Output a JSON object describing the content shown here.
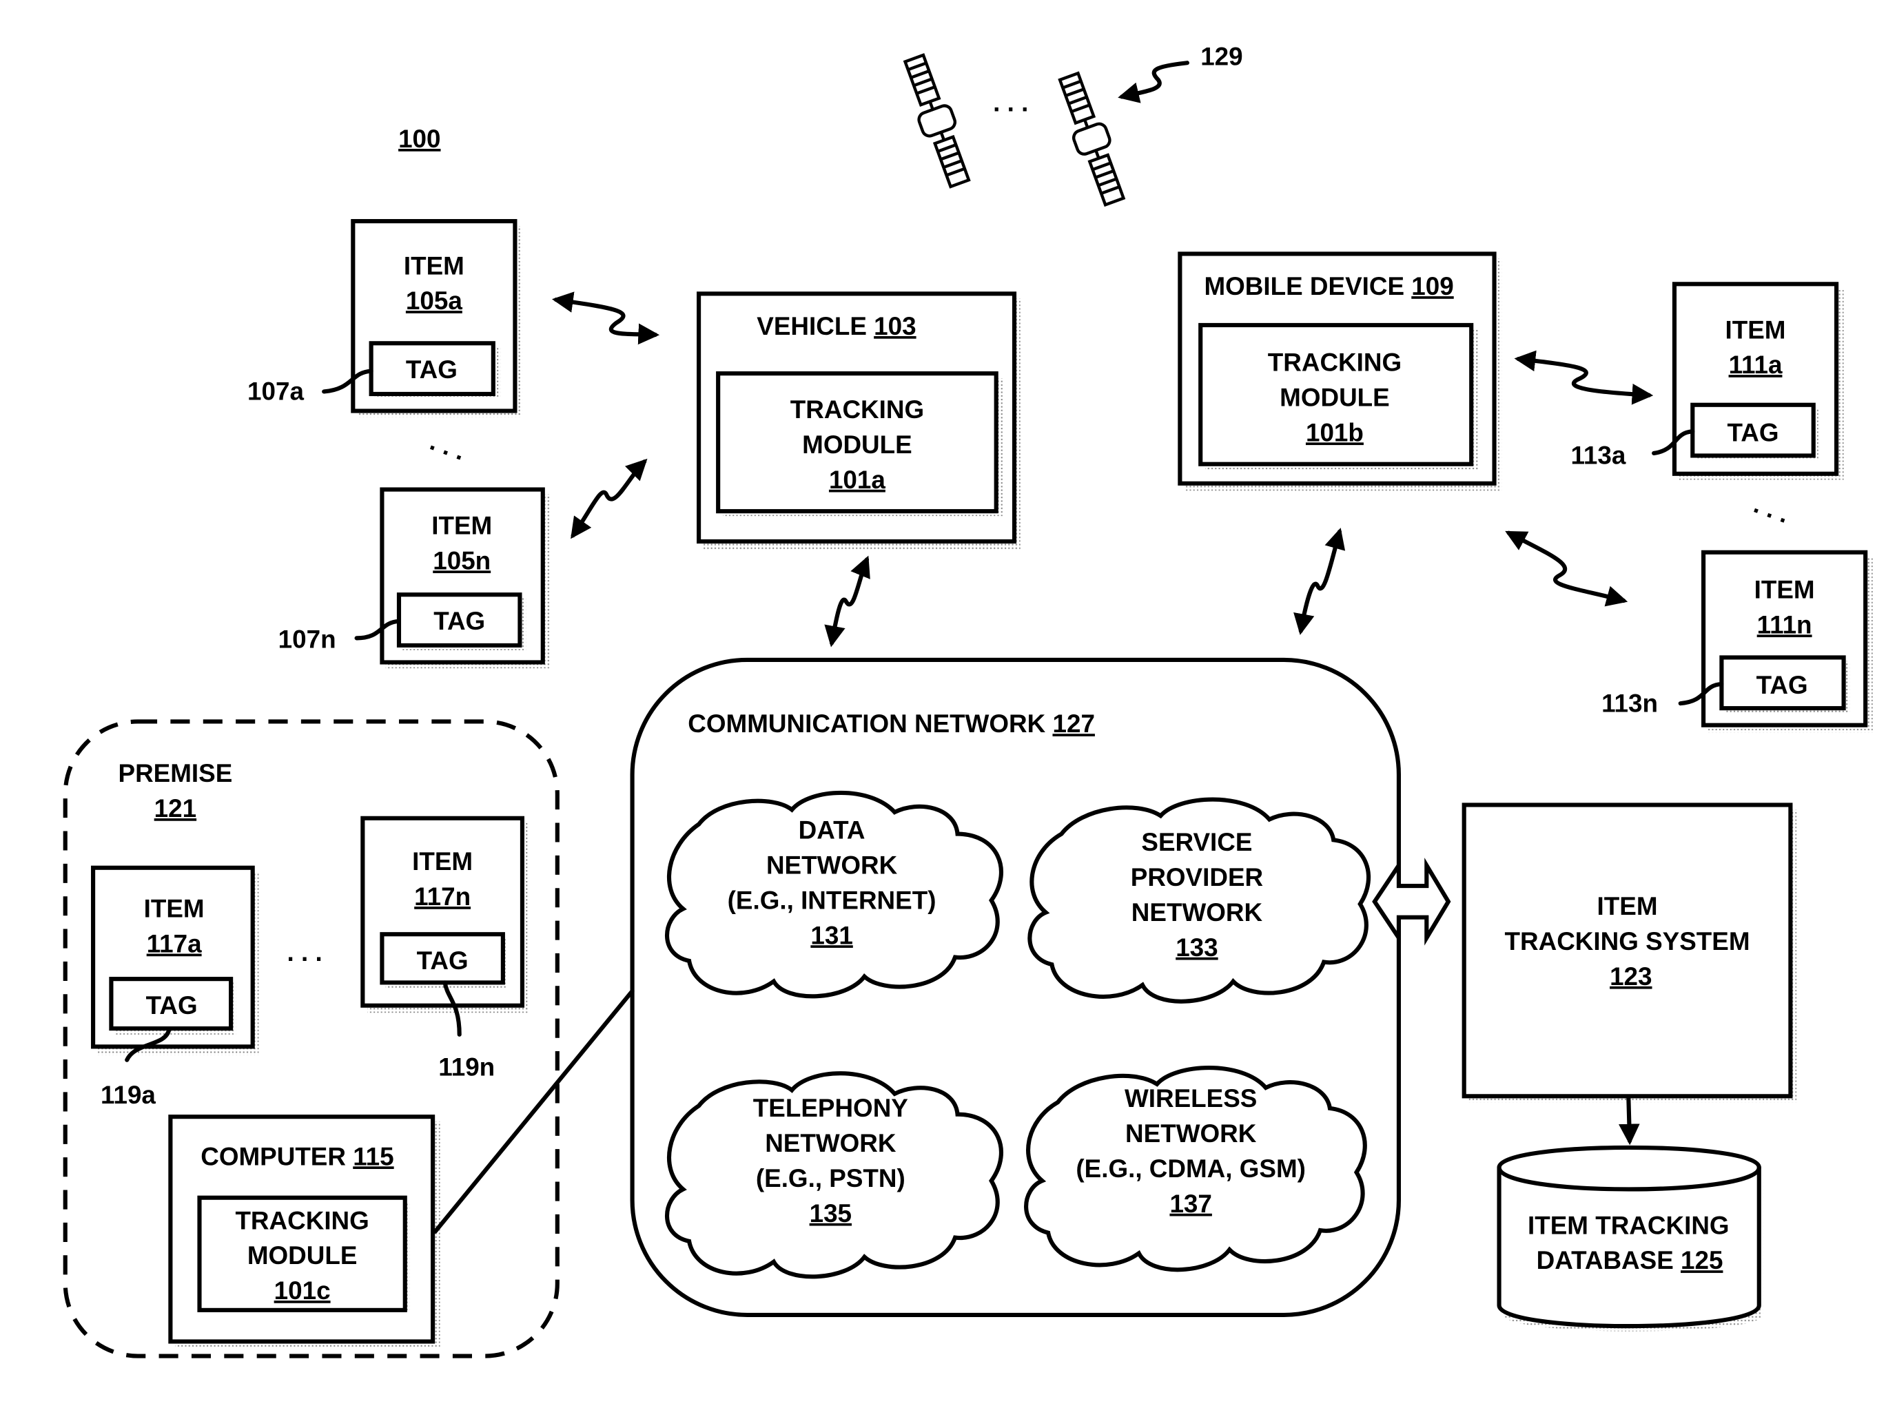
{
  "figure_label": "100",
  "satellites": {
    "ref": "129",
    "ellipsis": ". . ."
  },
  "items_left": [
    {
      "title": "ITEM",
      "ref": "105a",
      "tag": "TAG",
      "tag_ref": "107a"
    },
    {
      "title": "ITEM",
      "ref": "105n",
      "tag": "TAG",
      "tag_ref": "107n"
    }
  ],
  "vehicle": {
    "title": "VEHICLE",
    "ref": "103",
    "module_line1": "TRACKING",
    "module_line2": "MODULE",
    "module_ref": "101a"
  },
  "mobile": {
    "title": "MOBILE DEVICE",
    "ref": "109",
    "module_line1": "TRACKING",
    "module_line2": "MODULE",
    "module_ref": "101b"
  },
  "items_right": [
    {
      "title": "ITEM",
      "ref": "111a",
      "tag": "TAG",
      "tag_ref": "113a"
    },
    {
      "title": "ITEM",
      "ref": "111n",
      "tag": "TAG",
      "tag_ref": "113n"
    }
  ],
  "premise": {
    "title": "PREMISE",
    "ref": "121",
    "items": [
      {
        "title": "ITEM",
        "ref": "117a",
        "tag": "TAG",
        "tag_ref": "119a"
      },
      {
        "title": "ITEM",
        "ref": "117n",
        "tag": "TAG",
        "tag_ref": "119n"
      }
    ],
    "ellipsis": ". . .",
    "computer": {
      "title": "COMPUTER",
      "ref": "115",
      "module_line1": "TRACKING",
      "module_line2": "MODULE",
      "module_ref": "101c"
    }
  },
  "network": {
    "title": "COMMUNICATION NETWORK",
    "ref": "127",
    "clouds": [
      {
        "lines": [
          "DATA",
          "NETWORK",
          "(E.G., INTERNET)"
        ],
        "ref": "131"
      },
      {
        "lines": [
          "SERVICE",
          "PROVIDER",
          "NETWORK"
        ],
        "ref": "133"
      },
      {
        "lines": [
          "TELEPHONY",
          "NETWORK",
          "(E.G., PSTN)"
        ],
        "ref": "135"
      },
      {
        "lines": [
          "WIRELESS",
          "NETWORK",
          "(E.G., CDMA, GSM)"
        ],
        "ref": "137"
      }
    ]
  },
  "tracking_system": {
    "line1": "ITEM",
    "line2": "TRACKING SYSTEM",
    "ref": "123"
  },
  "database": {
    "line1": "ITEM TRACKING",
    "line2": "DATABASE",
    "ref": "125"
  },
  "ellipsis": ". . ."
}
